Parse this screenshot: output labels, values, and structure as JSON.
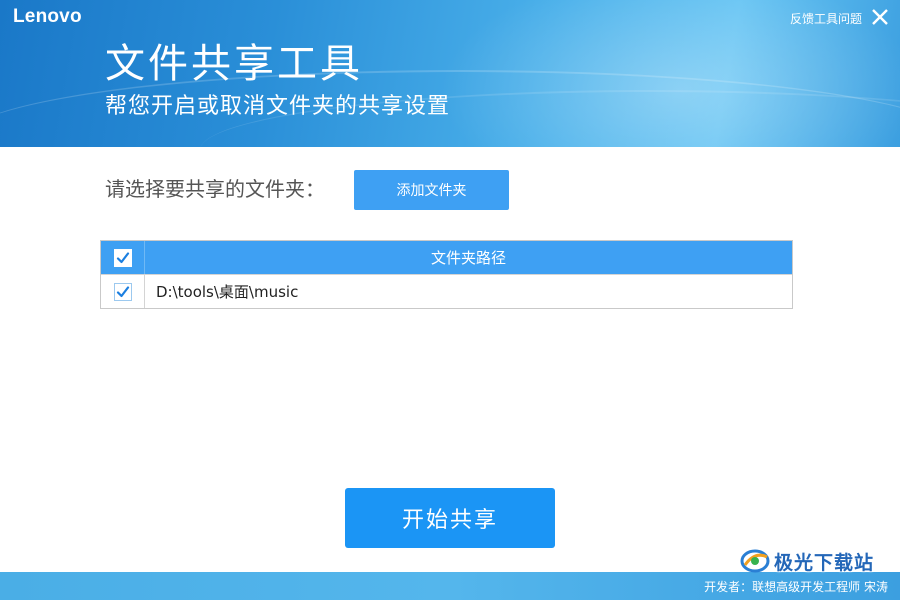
{
  "header": {
    "logo": "Lenovo",
    "feedback": "反馈工具问题",
    "title": "文件共享工具",
    "subtitle": "帮您开启或取消文件夹的共享设置"
  },
  "select": {
    "label": "请选择要共享的文件夹：",
    "add_button": "添加文件夹"
  },
  "table": {
    "column_header": "文件夹路径",
    "header_checked": true,
    "rows": [
      {
        "path": "D:\\tools\\桌面\\music",
        "checked": true
      }
    ]
  },
  "start_button": "开始共享",
  "footer": {
    "developer": "开发者：联想高级开发工程师 宋涛"
  },
  "watermark": {
    "text": "极光下载站"
  },
  "colors": {
    "accent": "#3ea0f3",
    "primary_button": "#1b95f5",
    "check": "#1b7fe0"
  }
}
